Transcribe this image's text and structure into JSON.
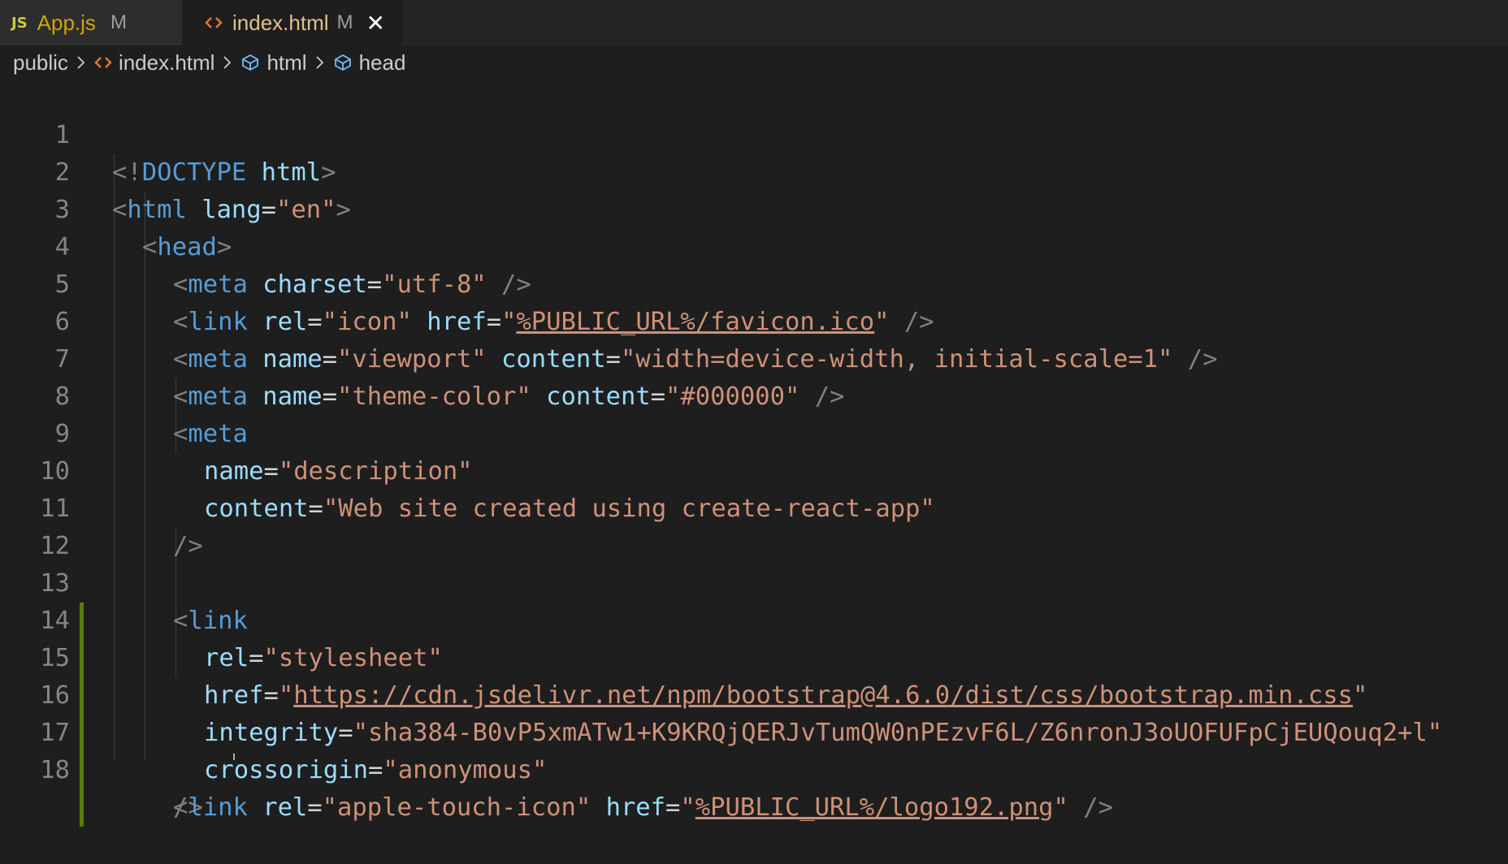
{
  "tabs": [
    {
      "icon": "js-file-icon",
      "icon_text": "JS",
      "label": "App.js",
      "status": "M",
      "active": false
    },
    {
      "icon": "html-file-icon",
      "label": "index.html",
      "status": "M",
      "active": true,
      "close": "✕"
    }
  ],
  "breadcrumb": [
    "public",
    "index.html",
    "html",
    "head"
  ],
  "editor": {
    "line_numbers": [
      "1",
      "2",
      "3",
      "4",
      "5",
      "6",
      "7",
      "8",
      "9",
      "10",
      "11",
      "12",
      "13",
      "14",
      "15",
      "16",
      "17",
      "18"
    ],
    "lines": [
      "<!DOCTYPE html>",
      "<html lang=\"en\">",
      "<head>",
      "<meta charset=\"utf-8\" />",
      "<link rel=\"icon\" href=\"%PUBLIC_URL%/favicon.ico\" />",
      "<meta name=\"viewport\" content=\"width=device-width, initial-scale=1\" />",
      "<meta name=\"theme-color\" content=\"#000000\" />",
      "<meta",
      "name=\"description\"",
      "content=\"Web site created using create-react-app\"",
      "/>",
      "<link",
      "rel=\"stylesheet\"",
      "href=\"https://cdn.jsdelivr.net/npm/bootstrap@4.6.0/dist/css/bootstrap.min.css\"",
      "integrity=\"sha384-B0vP5xmATw1+K9KRQjQERJvTumQW0nPEzvF6L/Z6nronJ3oUOFUFpCjEUQouq2+l\"",
      "crossorigin=\"anonymous\"",
      "/>",
      "<link rel=\"apple-touch-icon\" href=\"%PUBLIC_URL%/logo192.png\" />"
    ],
    "modified_lines": [
      "12",
      "13",
      "14",
      "15",
      "16",
      "17"
    ]
  },
  "colors": {
    "background": "#1e1e1e",
    "tag": "#569cd6",
    "attribute": "#9cdcfe",
    "string": "#ce9178",
    "punctuation": "#808080",
    "line_number": "#858585",
    "git_added": "#587c0c"
  }
}
